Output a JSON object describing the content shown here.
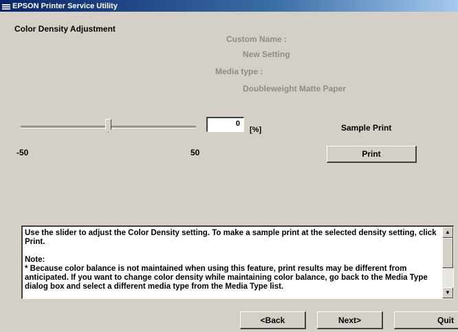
{
  "window": {
    "title": "EPSON Printer Service Utility"
  },
  "section_title": "Color Density Adjustment",
  "info": {
    "custom_name_label": "Custom Name :",
    "custom_name_value": "New Setting",
    "media_type_label": "Media type :",
    "media_type_value": "Doubleweight Matte Paper"
  },
  "slider": {
    "min_label": "-50",
    "max_label": "50",
    "min": -50,
    "max": 50,
    "value": 0,
    "value_text": "0",
    "unit": "[%]"
  },
  "sample_print": {
    "label": "Sample Print",
    "button": "Print"
  },
  "description": {
    "line1": "Use the slider to adjust the Color Density setting. To make a sample print at the selected density setting, click Print.",
    "note_heading": "Note:",
    "note_body": "* Because color balance is not maintained when using this feature, print results may be different from anticipated. If you want to change color density while maintaining color balance, go back to the Media Type dialog box and select a different media type from the Media Type list."
  },
  "nav": {
    "back": "<Back",
    "next": "Next>",
    "quit": "Quit"
  }
}
